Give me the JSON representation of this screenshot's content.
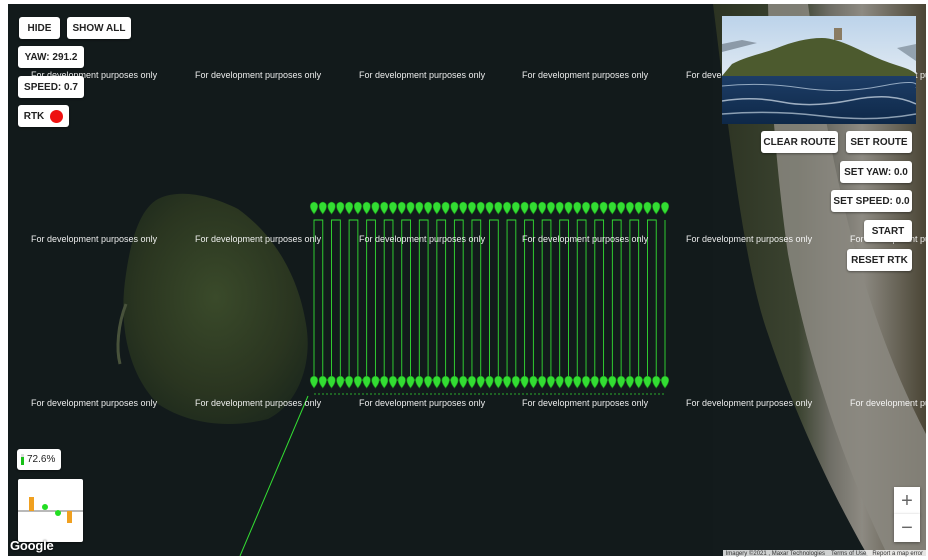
{
  "controls": {
    "hide_label": "HIDE",
    "show_all_label": "SHOW ALL",
    "yaw_label": "YAW: 291.2",
    "speed_label": "SPEED: 0.7",
    "rtk_label": "RTK",
    "rtk_status_color": "#ee1111",
    "battery_label": "72.6%",
    "battery_fraction": 0.726,
    "battery_color": "#18c018"
  },
  "route_controls": {
    "clear_route_label": "CLEAR ROUTE",
    "set_route_label": "SET ROUTE",
    "set_yaw_label": "SET YAW: 0.0",
    "set_speed_label": "SET SPEED: 0.0",
    "start_label": "START",
    "reset_rtk_label": "RESET RTK"
  },
  "watermark_text": "For development purposes only",
  "zoom": {
    "in_label": "+",
    "out_label": "−"
  },
  "attribution": {
    "imagery": "Imagery ©2021 , Maxar Technologies",
    "terms": "Terms of Use",
    "report": "Report a map error"
  },
  "google_logo": "Google",
  "colors": {
    "route": "#33dd33",
    "water": "#121a1b"
  }
}
